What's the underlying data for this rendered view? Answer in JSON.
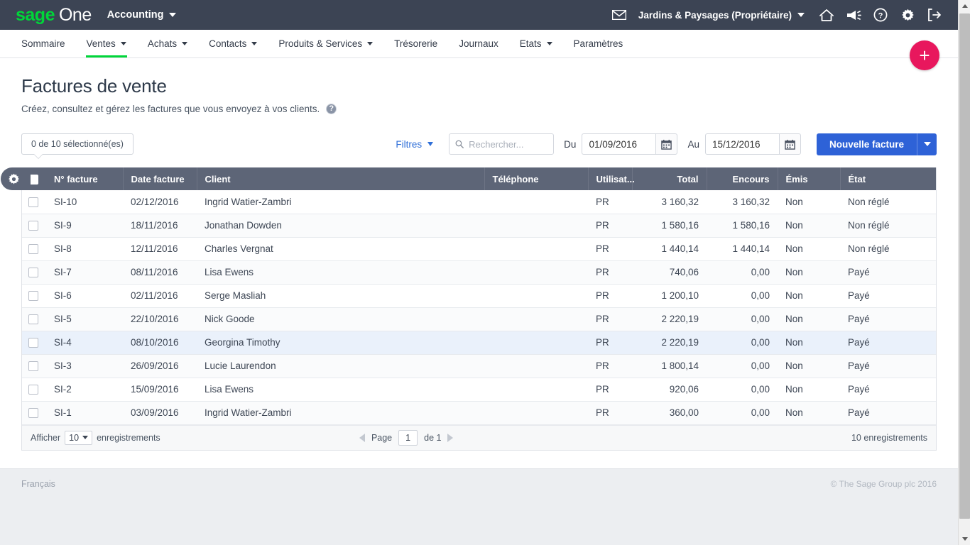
{
  "topbar": {
    "logo_sage": "sage",
    "logo_one": "One",
    "app_name": "Accounting",
    "mail_icon": "envelope-icon",
    "company": "Jardins & Paysages (Propriétaire)",
    "icons": [
      "home-icon",
      "megaphone-icon",
      "help-icon",
      "gear-icon",
      "logout-icon"
    ]
  },
  "nav": {
    "items": [
      {
        "label": "Sommaire",
        "caret": false,
        "active": false
      },
      {
        "label": "Ventes",
        "caret": true,
        "active": true
      },
      {
        "label": "Achats",
        "caret": true,
        "active": false
      },
      {
        "label": "Contacts",
        "caret": true,
        "active": false
      },
      {
        "label": "Produits & Services",
        "caret": true,
        "active": false
      },
      {
        "label": "Trésorerie",
        "caret": false,
        "active": false
      },
      {
        "label": "Journaux",
        "caret": false,
        "active": false
      },
      {
        "label": "Etats",
        "caret": true,
        "active": false
      },
      {
        "label": "Paramètres",
        "caret": false,
        "active": false
      }
    ]
  },
  "fab": {
    "label": "+"
  },
  "page": {
    "title": "Factures de vente",
    "subtitle": "Créez, consultez et gérez les factures que vous envoyez à vos clients.",
    "help_glyph": "?"
  },
  "toolbar": {
    "selection": "0 de 10 sélectionné(es)",
    "filters_label": "Filtres",
    "search_placeholder": "Rechercher...",
    "search_value": "",
    "date_from_label": "Du",
    "date_from_value": "01/09/2016",
    "date_to_label": "Au",
    "date_to_value": "15/12/2016",
    "new_button": "Nouvelle facture"
  },
  "table": {
    "columns": [
      "N° facture",
      "Date facture",
      "Client",
      "Téléphone",
      "Utilisat...",
      "Total",
      "Encours",
      "Émis",
      "État"
    ],
    "rows": [
      {
        "num": "SI-10",
        "date": "02/12/2016",
        "client": "Ingrid Watier-Zambri",
        "phone": "",
        "user": "PR",
        "total": "3 160,32",
        "encours": "3 160,32",
        "emis": "Non",
        "etat": "Non réglé"
      },
      {
        "num": "SI-9",
        "date": "18/11/2016",
        "client": "Jonathan Dowden",
        "phone": "",
        "user": "PR",
        "total": "1 580,16",
        "encours": "1 580,16",
        "emis": "Non",
        "etat": "Non réglé"
      },
      {
        "num": "SI-8",
        "date": "12/11/2016",
        "client": "Charles Vergnat",
        "phone": "",
        "user": "PR",
        "total": "1 440,14",
        "encours": "1 440,14",
        "emis": "Non",
        "etat": "Non réglé"
      },
      {
        "num": "SI-7",
        "date": "08/11/2016",
        "client": "Lisa Ewens",
        "phone": "",
        "user": "PR",
        "total": "740,06",
        "encours": "0,00",
        "emis": "Non",
        "etat": "Payé"
      },
      {
        "num": "SI-6",
        "date": "02/11/2016",
        "client": "Serge Masliah",
        "phone": "",
        "user": "PR",
        "total": "1 200,10",
        "encours": "0,00",
        "emis": "Non",
        "etat": "Payé"
      },
      {
        "num": "SI-5",
        "date": "22/10/2016",
        "client": "Nick Goode",
        "phone": "",
        "user": "PR",
        "total": "2 220,19",
        "encours": "0,00",
        "emis": "Non",
        "etat": "Payé"
      },
      {
        "num": "SI-4",
        "date": "08/10/2016",
        "client": "Georgina Timothy",
        "phone": "",
        "user": "PR",
        "total": "2 220,19",
        "encours": "0,00",
        "emis": "Non",
        "etat": "Payé"
      },
      {
        "num": "SI-3",
        "date": "26/09/2016",
        "client": "Lucie Laurendon",
        "phone": "",
        "user": "PR",
        "total": "1 800,14",
        "encours": "0,00",
        "emis": "Non",
        "etat": "Payé"
      },
      {
        "num": "SI-2",
        "date": "15/09/2016",
        "client": "Lisa Ewens",
        "phone": "",
        "user": "PR",
        "total": "920,06",
        "encours": "0,00",
        "emis": "Non",
        "etat": "Payé"
      },
      {
        "num": "SI-1",
        "date": "03/09/2016",
        "client": "Ingrid Watier-Zambri",
        "phone": "",
        "user": "PR",
        "total": "360,00",
        "encours": "0,00",
        "emis": "Non",
        "etat": "Payé"
      }
    ],
    "highlighted_row_index": 6
  },
  "table_footer": {
    "show_label": "Afficher",
    "page_size": "10",
    "records_label": "enregistrements",
    "page_label": "Page",
    "page_value": "1",
    "of_label": "de 1",
    "total_records": "10 enregistrements"
  },
  "footer": {
    "language": "Français",
    "copyright": "© The Sage Group plc 2016"
  },
  "colors": {
    "topbar_bg": "#3c4454",
    "brand_green": "#00d639",
    "accent_blue": "#2e62d7",
    "fab_pink": "#e8175d",
    "table_header": "#5d6577",
    "row_highlight": "#eaf1fb"
  }
}
